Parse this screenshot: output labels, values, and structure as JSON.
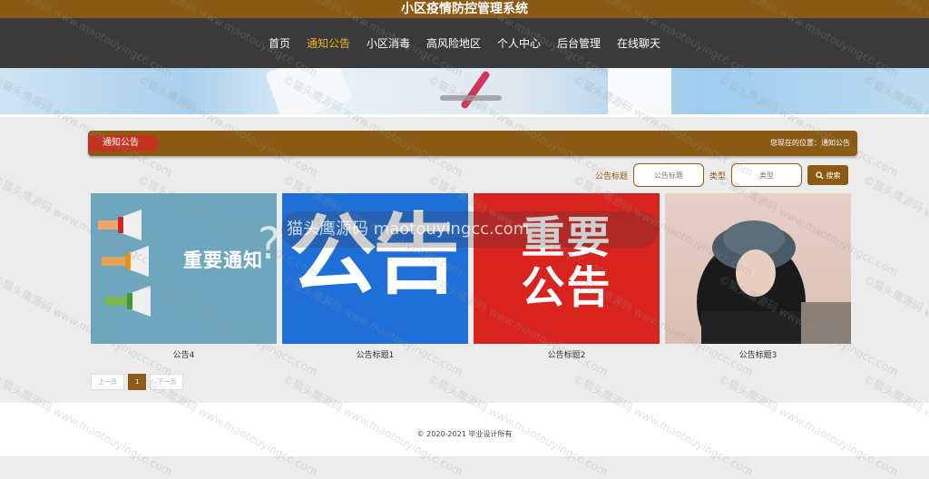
{
  "app_title": "小区疫情防控管理系统",
  "nav": [
    {
      "label": "首页",
      "active": false
    },
    {
      "label": "通知公告",
      "active": true
    },
    {
      "label": "小区消毒",
      "active": false
    },
    {
      "label": "高风险地区",
      "active": false
    },
    {
      "label": "个人中心",
      "active": false
    },
    {
      "label": "后台管理",
      "active": false
    },
    {
      "label": "在线聊天",
      "active": false
    }
  ],
  "breadcrumb": {
    "section_title": "通知公告",
    "location_text": "您现在的位置：通知公告"
  },
  "search": {
    "title_label": "公告标题",
    "title_placeholder": "公告标题",
    "type_label": "类型",
    "type_placeholder": "类型",
    "button_label": "搜索"
  },
  "cards": [
    {
      "caption": "公告4",
      "image_text": "重要通知"
    },
    {
      "caption": "公告标题1",
      "image_text": "公告"
    },
    {
      "caption": "公告标题2",
      "image_text": "重要\n公告"
    },
    {
      "caption": "公告标题3",
      "image_text": ""
    }
  ],
  "pager": {
    "prev": "上一页",
    "current": "1",
    "next": "下一页"
  },
  "footer": {
    "copyright": "© 2020-2021 毕业设计所有"
  },
  "watermark": {
    "overlay": "猫头鹰源码 maotouyingcc.com",
    "repeat": "©猫头鹰源码 www.maotouyingcc.com"
  },
  "colors": {
    "brand": "#8b5a14",
    "accent_red": "#c4331f",
    "nav_bg": "#3a3a3a",
    "nav_active": "#f0b323"
  }
}
